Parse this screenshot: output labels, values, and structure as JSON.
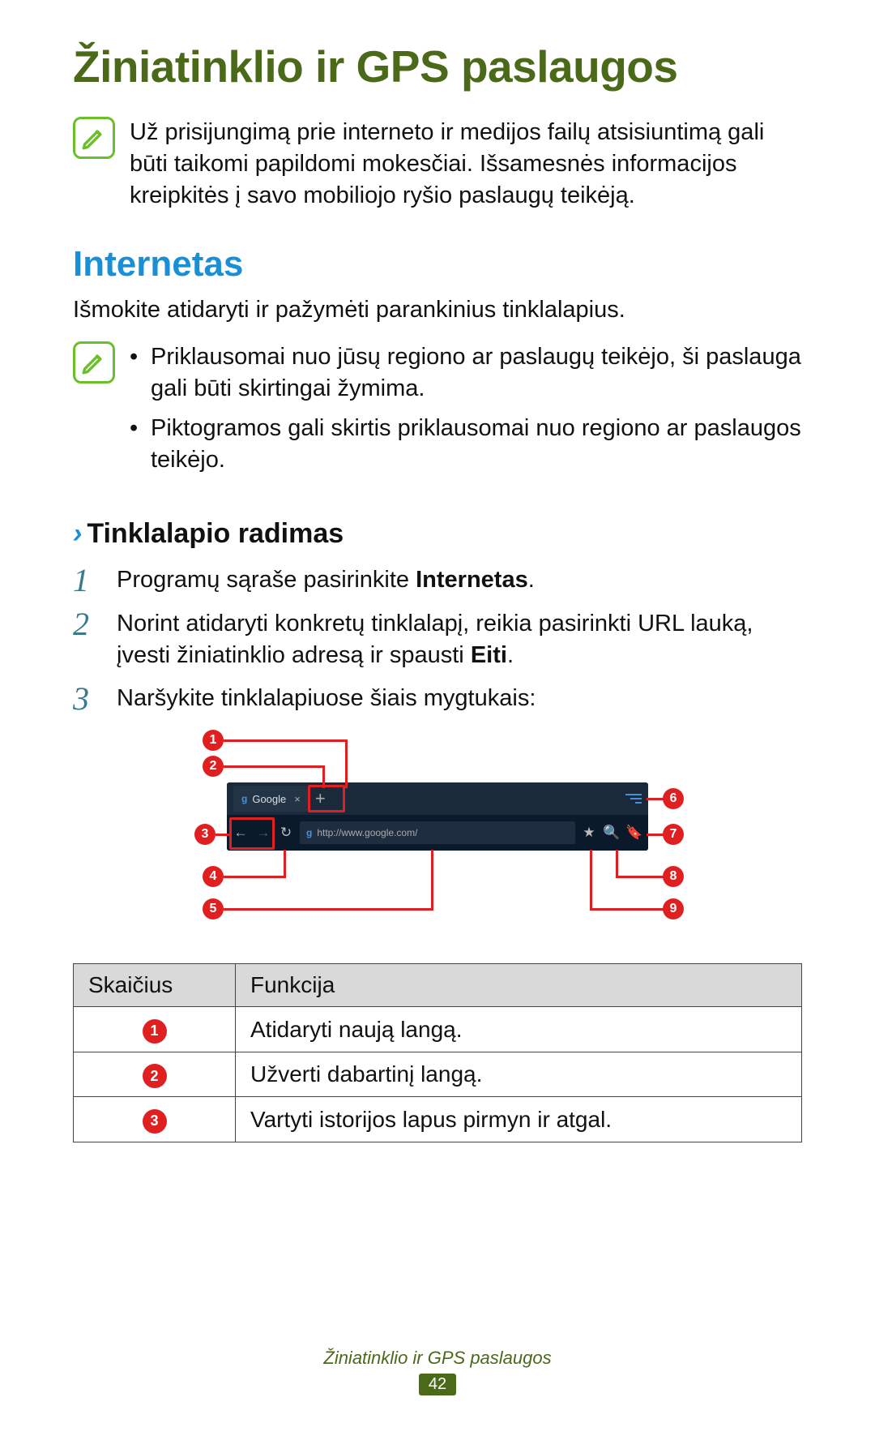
{
  "title": "Žiniatinklio ir GPS paslaugos",
  "intro_note": "Už prisijungimą prie interneto ir medijos failų atsisiuntimą gali būti taikomi papildomi mokesčiai. Išsamesnės informacijos kreipkitės į savo mobiliojo ryšio paslaugų teikėją.",
  "section": {
    "heading": "Internetas",
    "intro": "Išmokite atidaryti ir pažymėti parankinius tinklalapius.",
    "notes": [
      "Priklausomai nuo jūsų regiono ar paslaugų teikėjo, ši paslauga gali būti skirtingai žymima.",
      "Piktogramos gali skirtis priklausomai nuo regiono ar paslaugos teikėjo."
    ]
  },
  "subsection_heading": "Tinklalapio radimas",
  "steps": {
    "s1_a": "Programų sąraše pasirinkite ",
    "s1_b": "Internetas",
    "s1_c": ".",
    "s2_a": "Norint atidaryti konkretų tinklalapį, reikia pasirinkti URL lauką, įvesti žiniatinklio adresą ir spausti ",
    "s2_b": "Eiti",
    "s2_c": ".",
    "s3": "Naršykite tinklalapiuose šiais mygtukais:"
  },
  "step_nums": {
    "n1": "1",
    "n2": "2",
    "n3": "3"
  },
  "diagram": {
    "tab_label": "Google",
    "url": "http://www.google.com/",
    "callouts": [
      "1",
      "2",
      "3",
      "4",
      "5",
      "6",
      "7",
      "8",
      "9"
    ]
  },
  "table": {
    "head_num": "Skaičius",
    "head_func": "Funkcija",
    "rows": [
      {
        "n": "1",
        "f": "Atidaryti naują langą."
      },
      {
        "n": "2",
        "f": "Užverti dabartinį langą."
      },
      {
        "n": "3",
        "f": "Vartyti istorijos lapus pirmyn ir atgal."
      }
    ]
  },
  "footer": {
    "title": "Žiniatinklio ir GPS paslaugos",
    "page": "42"
  }
}
